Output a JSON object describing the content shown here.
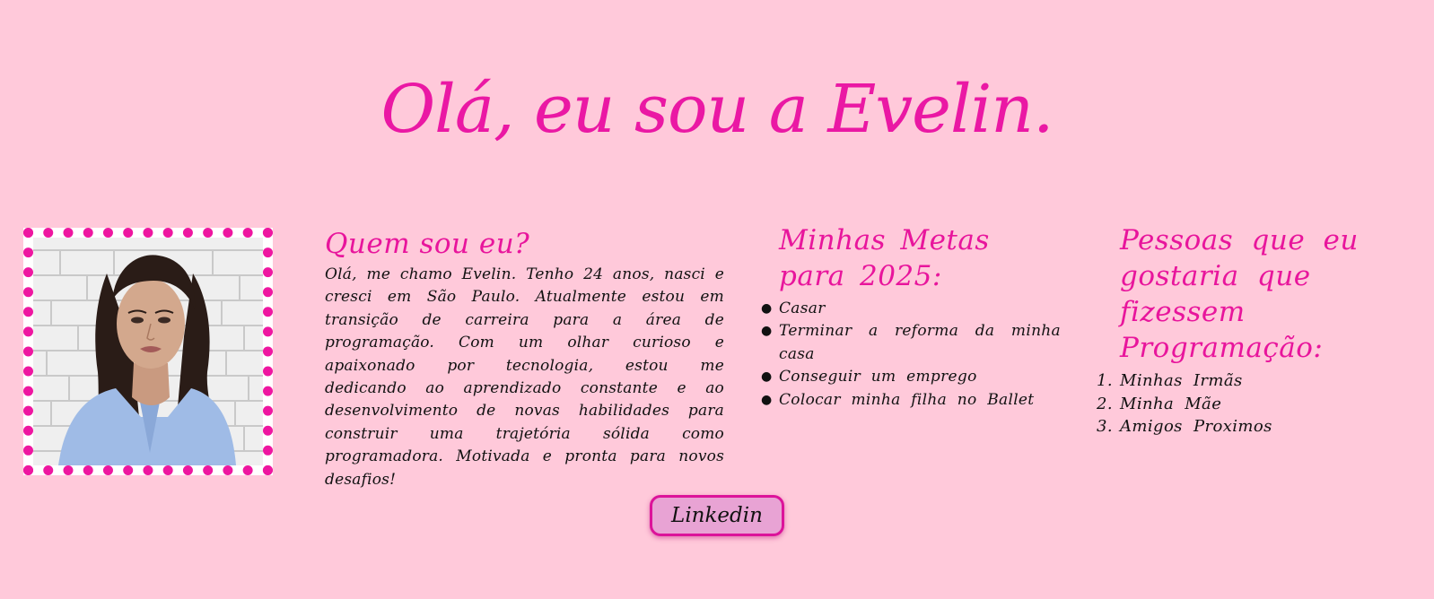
{
  "page": {
    "title": "Olá, eu sou a Evelin."
  },
  "about": {
    "heading": "Quem sou eu?",
    "text": "Olá, me chamo Evelin. Tenho 24 anos, nasci e cresci em São Paulo. Atualmente estou em transição de carreira para a área de programação. Com um olhar curioso e apaixonado por tecnologia, estou me dedicando ao aprendizado constante e ao desenvolvimento de novas habilidades para construir uma trajetória sólida como programadora. Motivada e pronta para novos desafios!"
  },
  "goals": {
    "heading": "Minhas Metas para 2025:",
    "items": [
      "Casar",
      "Terminar a reforma da minha casa",
      "Conseguir um emprego",
      "Colocar minha filha no Ballet"
    ]
  },
  "people": {
    "heading": "Pessoas que eu gostaria que fizessem Programação:",
    "items": [
      "Minhas Irmãs",
      "Minha Mãe",
      "Amigos Proximos"
    ],
    "numbers": [
      "1.",
      "2.",
      "3."
    ]
  },
  "button": {
    "label": "Linkedin"
  },
  "colors": {
    "background": "#ffc9da",
    "accent": "#ea18a4",
    "button_bg": "#e8a3d4",
    "text": "#111111"
  },
  "icons": {
    "goal_bullet": "bullet-dot"
  }
}
